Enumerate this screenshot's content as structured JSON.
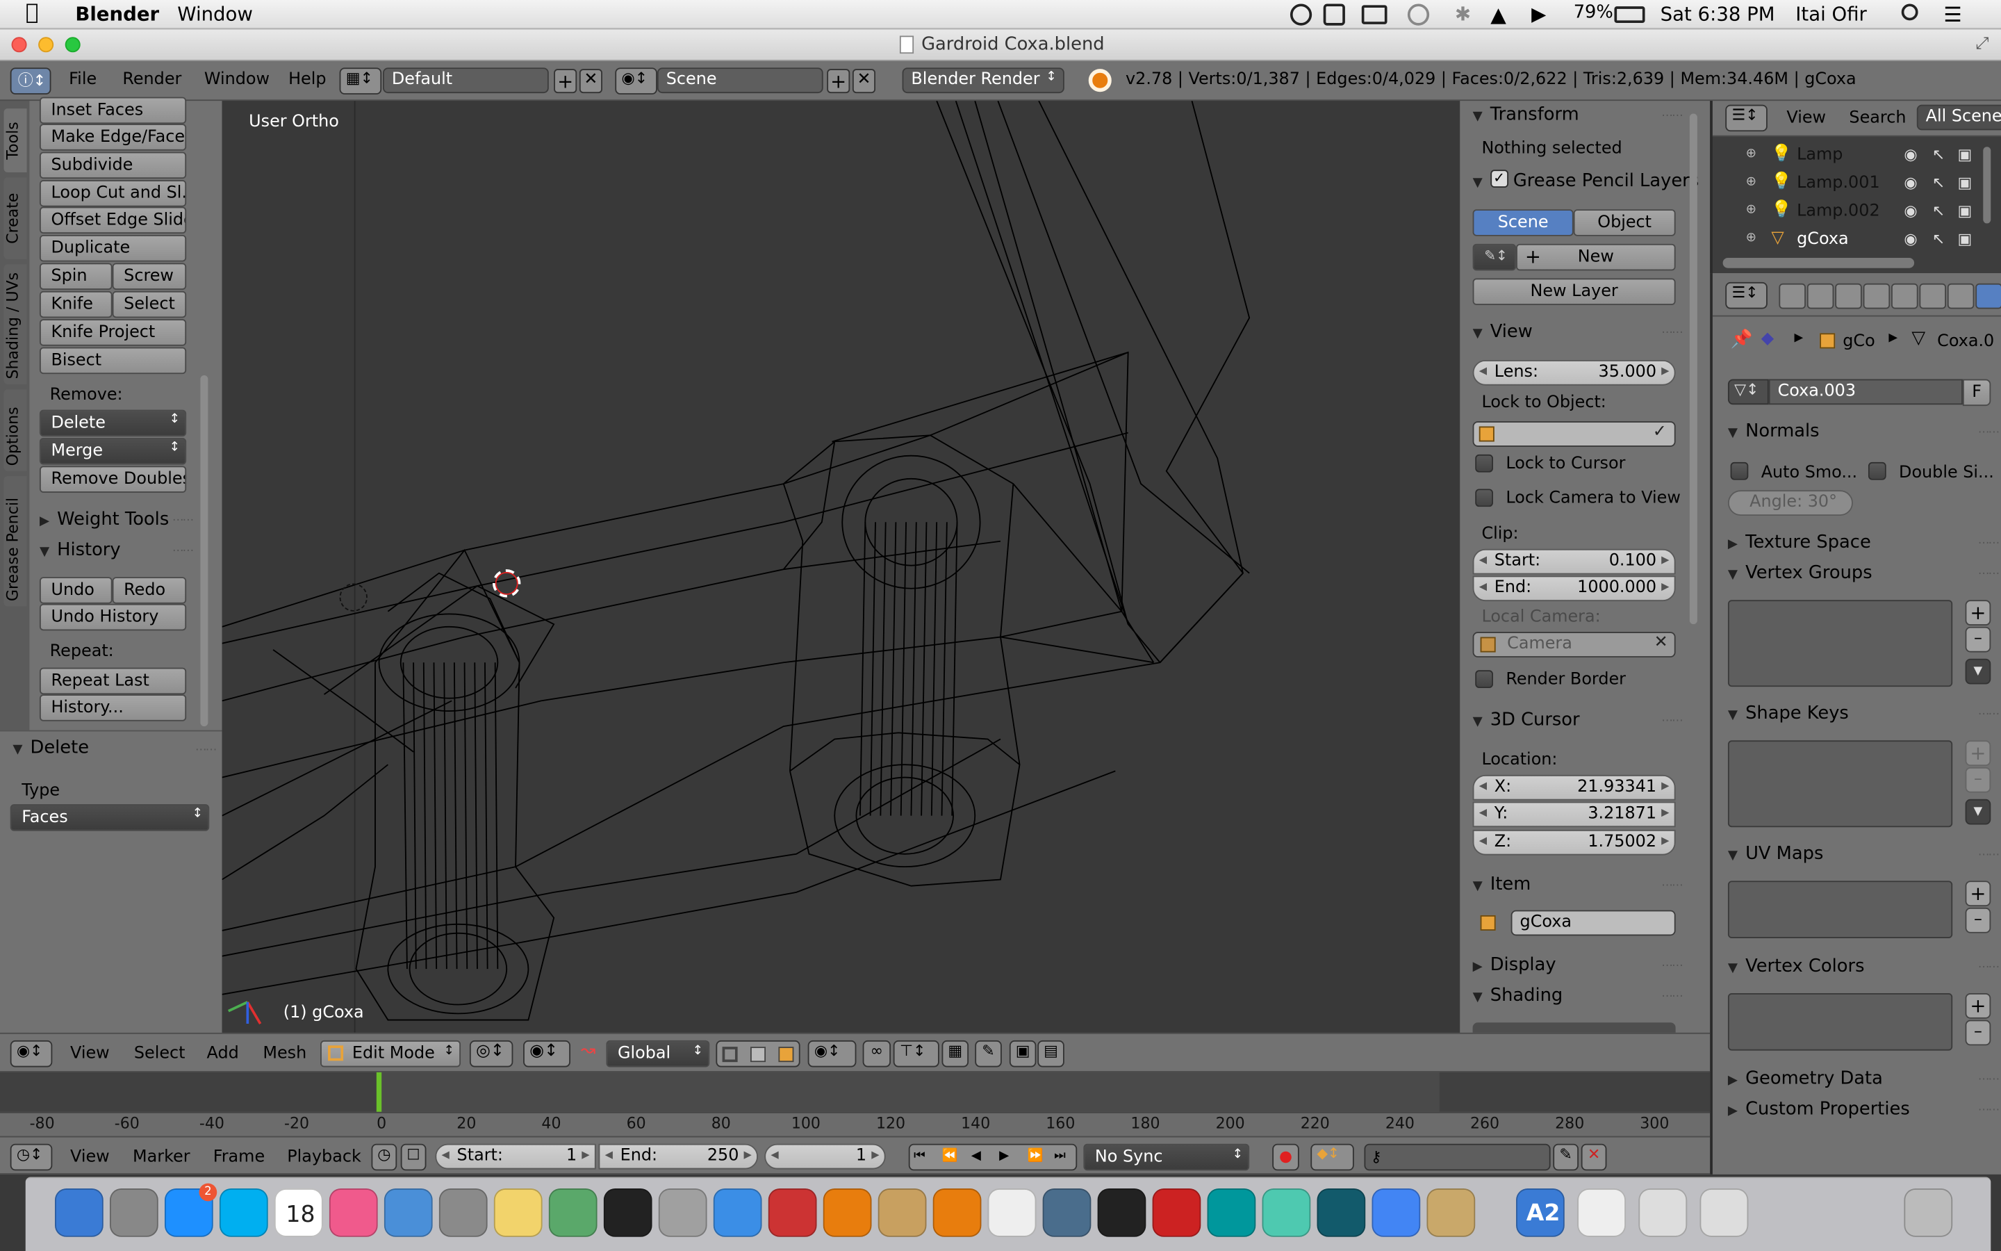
{
  "menubar": {
    "apple": "",
    "app": "Blender",
    "items": [
      "Window"
    ],
    "battery": "79%",
    "clock": "Sat 6:38 PM",
    "user": "Itai Ofir"
  },
  "window": {
    "title": "Gardroid Coxa.blend"
  },
  "info_header": {
    "menus": [
      "File",
      "Render",
      "Window",
      "Help"
    ],
    "layout": "Default",
    "scene": "Scene",
    "engine": "Blender Render",
    "stats": "v2.78 | Verts:0/1,387 | Edges:0/4,029 | Faces:0/2,622 | Tris:2,639 | Mem:34.46M | gCoxa"
  },
  "tool_tabs": [
    "Tools",
    "Create",
    "Shading / UVs",
    "Options",
    "Grease Pencil"
  ],
  "tools": {
    "buttons": [
      "Inset Faces",
      "Make Edge/Face",
      "Subdivide",
      "Loop Cut and Sl...",
      "Offset Edge Slide"
    ],
    "duplicate": "Duplicate",
    "spin": "Spin",
    "screw": "Screw",
    "knife": "Knife",
    "select": "Select",
    "knife_project": "Knife Project",
    "bisect": "Bisect",
    "remove_label": "Remove:",
    "delete": "Delete",
    "merge": "Merge",
    "remove_doubles": "Remove Doubles",
    "weight_tools": "Weight Tools",
    "history": "History",
    "undo": "Undo",
    "redo": "Redo",
    "undo_history": "Undo History",
    "repeat_label": "Repeat:",
    "repeat_last": "Repeat Last",
    "history_dots": "History..."
  },
  "operator": {
    "title": "Delete",
    "type_label": "Type",
    "type_value": "Faces"
  },
  "viewport": {
    "view_name": "User Ortho",
    "object_label": "(1) gCoxa"
  },
  "properties": {
    "transform": "Transform",
    "nothing_selected": "Nothing selected",
    "grease_pencil": "Grease Pencil Layers",
    "scene_tab": "Scene",
    "object_tab": "Object",
    "new": "New",
    "new_layer": "New Layer",
    "view": "View",
    "lens_label": "Lens:",
    "lens_value": "35.000",
    "lock_to_object": "Lock to Object:",
    "lock_to_cursor": "Lock to Cursor",
    "lock_camera": "Lock Camera to View",
    "clip": "Clip:",
    "clip_start_label": "Start:",
    "clip_start": "0.100",
    "clip_end_label": "End:",
    "clip_end": "1000.000",
    "local_camera": "Local Camera:",
    "camera": "Camera",
    "render_border": "Render Border",
    "cursor": "3D Cursor",
    "location": "Location:",
    "x_label": "X:",
    "x": "21.93341",
    "y_label": "Y:",
    "y": "3.21871",
    "z_label": "Z:",
    "z": "1.75002",
    "item": "Item",
    "item_name": "gCoxa",
    "display": "Display",
    "shading": "Shading"
  },
  "view3d_header": {
    "menus": [
      "View",
      "Select",
      "Add",
      "Mesh"
    ],
    "mode": "Edit Mode",
    "orientation": "Global"
  },
  "timeline": {
    "ticks": [
      "-80",
      "-60",
      "-40",
      "-20",
      "0",
      "20",
      "40",
      "60",
      "80",
      "100",
      "120",
      "140",
      "160",
      "180",
      "200",
      "220",
      "240",
      "260",
      "280",
      "300"
    ],
    "menus": [
      "View",
      "Marker",
      "Frame",
      "Playback"
    ],
    "start_label": "Start:",
    "start": "1",
    "end_label": "End:",
    "end": "250",
    "current": "1",
    "sync": "No Sync"
  },
  "outliner": {
    "menus": [
      "View",
      "Search"
    ],
    "filter": "All Scenes",
    "items": [
      "Lamp",
      "Lamp.001",
      "Lamp.002",
      "gCoxa"
    ]
  },
  "data_props": {
    "crumb_obj": "gCo",
    "crumb_mesh": "Coxa.0",
    "mesh_name": "Coxa.003",
    "fake_user": "F",
    "normals": "Normals",
    "auto_smooth": "Auto Smo...",
    "double_sided": "Double Si...",
    "angle": "Angle:  30°",
    "texture_space": "Texture Space",
    "vertex_groups": "Vertex Groups",
    "shape_keys": "Shape Keys",
    "uv_maps": "UV Maps",
    "vertex_colors": "Vertex Colors",
    "geometry_data": "Geometry Data",
    "custom_props": "Custom Properties"
  },
  "dock": {
    "calendar_day": "18",
    "badge": "2",
    "a2": "A2"
  },
  "colors": {
    "viewport": "#393939",
    "panel": "#727272",
    "selected_tab": "#5680c2",
    "frame_marker": "#6ac12a"
  }
}
